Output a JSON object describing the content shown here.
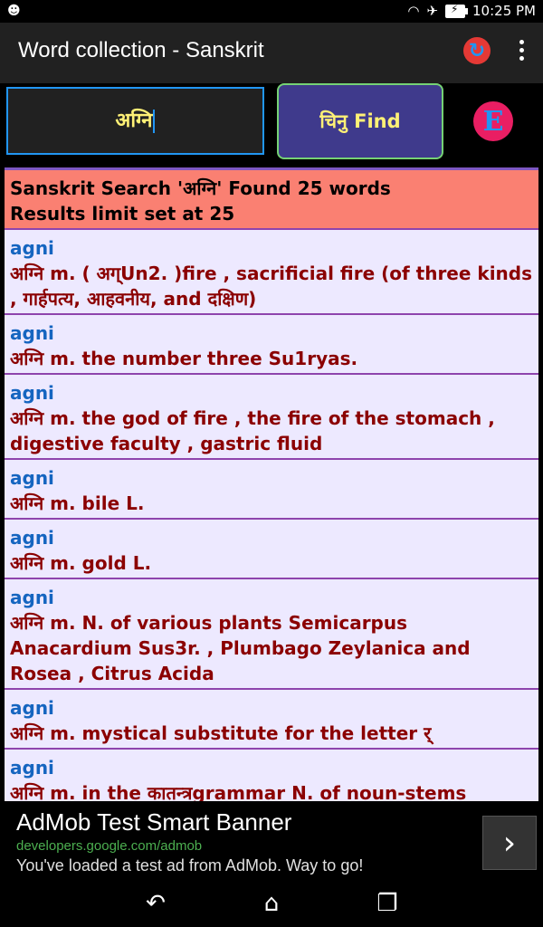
{
  "status_bar": {
    "time": "10:25 PM",
    "android_icon": "android-icon",
    "wifi_icon": "wifi-icon",
    "airplane_icon": "airplane-icon",
    "battery_icon": "battery-charging-icon"
  },
  "app_bar": {
    "title": "Word collection - Sanskrit",
    "refresh_icon": "refresh-icon",
    "overflow_icon": "overflow-menu-icon"
  },
  "controls": {
    "search_value": "अग्नि",
    "find_label": "चिनु Find",
    "e_label": "E"
  },
  "results": {
    "header_line1": "Sanskrit Search 'अग्नि' Found 25 words",
    "header_line2": "Results limit set at 25",
    "entries": [
      {
        "word": "agni",
        "definition": "अग्नि m. ( अग्Un2. )fire , sacrificial fire (of three kinds , गार्हपत्य, आहवनीय, and दक्षिण)"
      },
      {
        "word": "agni",
        "definition": "अग्नि m. the number three Su1ryas."
      },
      {
        "word": "agni",
        "definition": "अग्नि m. the god of fire , the fire of the stomach , digestive faculty , gastric fluid"
      },
      {
        "word": "agni",
        "definition": "अग्नि m. bile L."
      },
      {
        "word": "agni",
        "definition": "अग्नि m. gold L."
      },
      {
        "word": "agni",
        "definition": "अग्नि m. N. of various plants Semicarpus Anacardium Sus3r. , Plumbago Zeylanica and Rosea , Citrus Acida"
      },
      {
        "word": "agni",
        "definition": "अग्नि m. mystical substitute for the letter र्"
      },
      {
        "word": "agni",
        "definition": "अग्नि m. in the कातन्त्रgrammar N. of noun-stems ending in इand उ([ cf. Lat. igni-s ; Lith. ugni-s ; Slav."
      }
    ]
  },
  "ad": {
    "title": "AdMob Test Smart Banner",
    "url": "developers.google.com/admob",
    "message": "You've loaded a test ad from AdMob. Way to go!",
    "arrow": "›"
  },
  "nav": {
    "back_icon": "back-icon",
    "home_icon": "home-icon",
    "recents_icon": "recents-icon"
  }
}
